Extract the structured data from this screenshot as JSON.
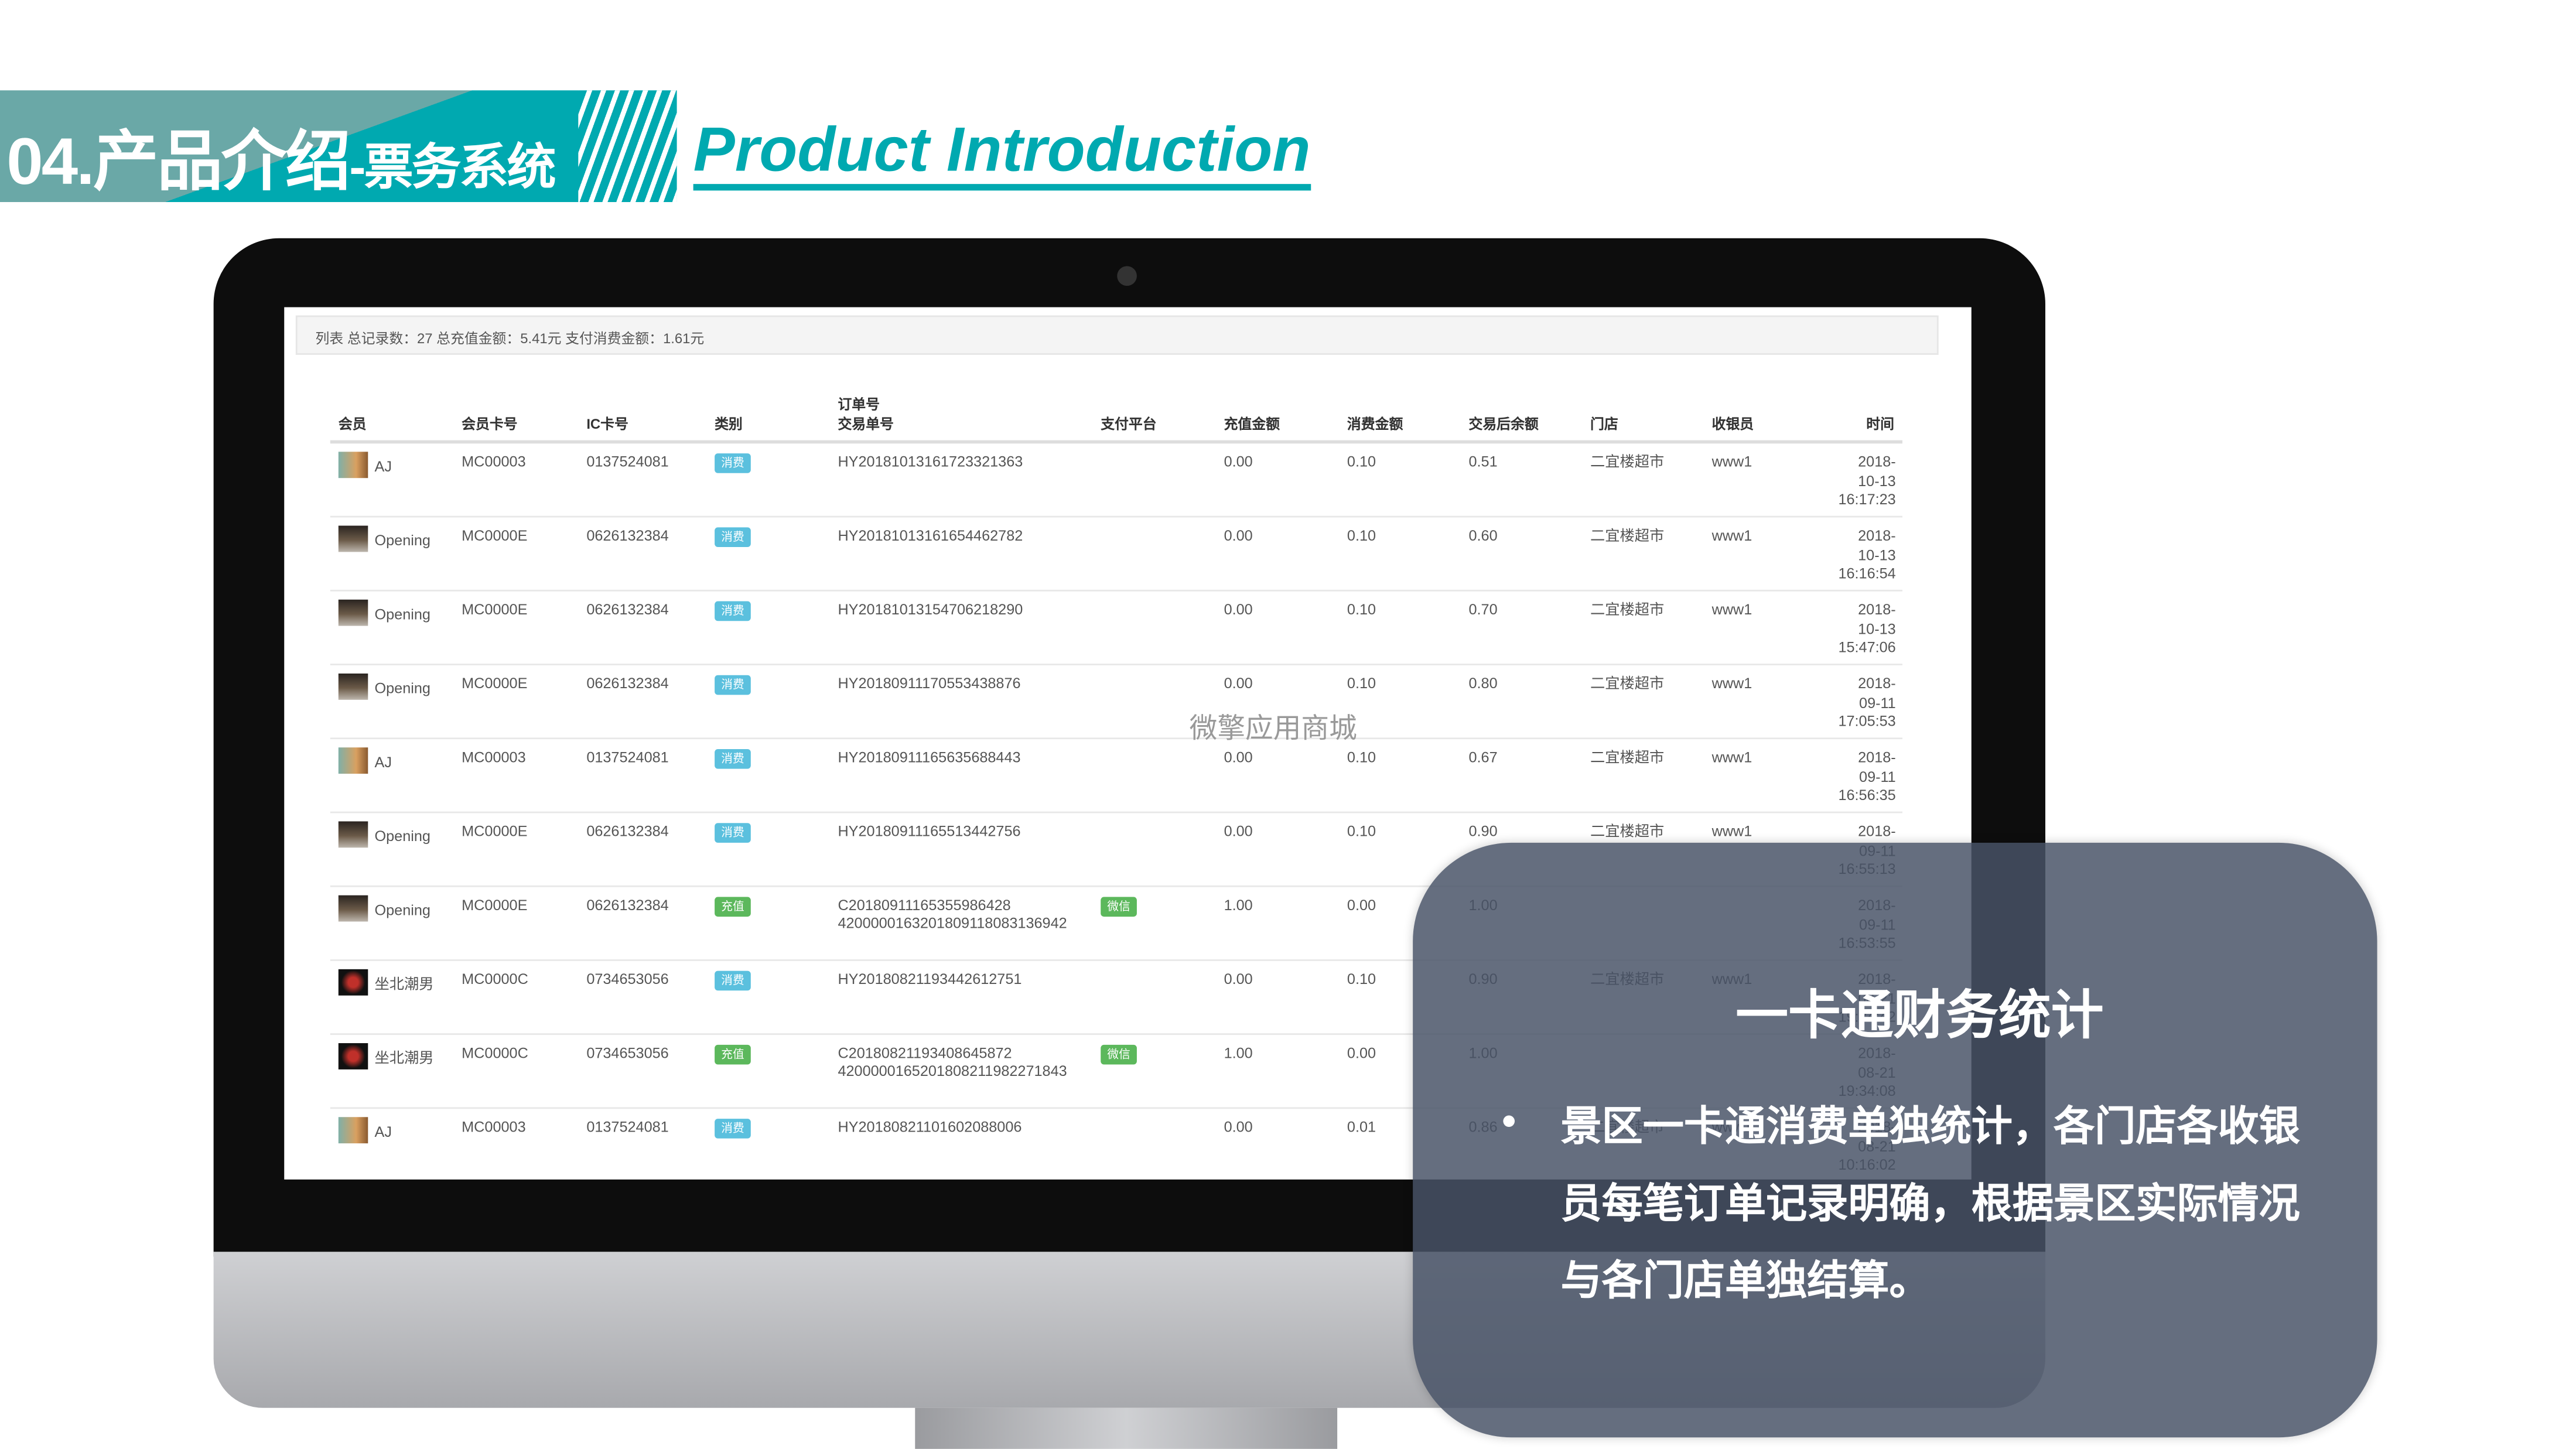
{
  "header": {
    "title": "04.产品介绍",
    "subtitle": "-票务系统",
    "english": "Product Introduction"
  },
  "colors": {
    "teal": "#00a9b0",
    "teal_gray": "#6aa8a7",
    "badge_consume": "#5bc0de",
    "badge_recharge": "#5cb85c",
    "panel": "#485266"
  },
  "screen": {
    "summary": "列表  总记录数：27  总充值金额：5.41元  支付消费金额：1.61元",
    "columns": {
      "member": "会员",
      "card_no": "会员卡号",
      "ic": "IC卡号",
      "type": "类别",
      "order_no": "订单号",
      "trade_no": "交易单号",
      "platform": "支付平台",
      "recharge": "充值金额",
      "consume": "消费金额",
      "balance": "交易后余额",
      "store": "门店",
      "cashier": "收银员",
      "time": "时间"
    },
    "watermark": "微擎应用商城",
    "rows": [
      {
        "avatar": "photo-icon",
        "name": "AJ",
        "card": "MC00003",
        "ic": "0137524081",
        "type": "消费",
        "order": "HY20181013161723321363",
        "trade": "",
        "platform": "",
        "recharge": "0.00",
        "consume": "0.10",
        "balance": "0.51",
        "store": "二宜楼超市",
        "cashier": "www1",
        "time": [
          "2018-",
          "10-13",
          "16:17:23"
        ]
      },
      {
        "avatar": "photo-icon",
        "name": "Opening",
        "card": "MC0000E",
        "ic": "0626132384",
        "type": "消费",
        "order": "HY20181013161654462782",
        "trade": "",
        "platform": "",
        "recharge": "0.00",
        "consume": "0.10",
        "balance": "0.60",
        "store": "二宜楼超市",
        "cashier": "www1",
        "time": [
          "2018-",
          "10-13",
          "16:16:54"
        ]
      },
      {
        "avatar": "photo-icon",
        "name": "Opening",
        "card": "MC0000E",
        "ic": "0626132384",
        "type": "消费",
        "order": "HY20181013154706218290",
        "trade": "",
        "platform": "",
        "recharge": "0.00",
        "consume": "0.10",
        "balance": "0.70",
        "store": "二宜楼超市",
        "cashier": "www1",
        "time": [
          "2018-",
          "10-13",
          "15:47:06"
        ]
      },
      {
        "avatar": "photo-icon",
        "name": "Opening",
        "card": "MC0000E",
        "ic": "0626132384",
        "type": "消费",
        "order": "HY20180911170553438876",
        "trade": "",
        "platform": "",
        "recharge": "0.00",
        "consume": "0.10",
        "balance": "0.80",
        "store": "二宜楼超市",
        "cashier": "www1",
        "time": [
          "2018-",
          "09-11",
          "17:05:53"
        ]
      },
      {
        "avatar": "photo-icon",
        "name": "AJ",
        "card": "MC00003",
        "ic": "0137524081",
        "type": "消费",
        "order": "HY20180911165635688443",
        "trade": "",
        "platform": "",
        "recharge": "0.00",
        "consume": "0.10",
        "balance": "0.67",
        "store": "二宜楼超市",
        "cashier": "www1",
        "time": [
          "2018-",
          "09-11",
          "16:56:35"
        ]
      },
      {
        "avatar": "photo-icon",
        "name": "Opening",
        "card": "MC0000E",
        "ic": "0626132384",
        "type": "消费",
        "order": "HY20180911165513442756",
        "trade": "",
        "platform": "",
        "recharge": "0.00",
        "consume": "0.10",
        "balance": "0.90",
        "store": "二宜楼超市",
        "cashier": "www1",
        "time": [
          "2018-",
          "09-11",
          "16:55:13"
        ]
      },
      {
        "avatar": "photo-icon",
        "name": "Opening",
        "card": "MC0000E",
        "ic": "0626132384",
        "type": "充值",
        "order": "C20180911165355986428",
        "trade": "4200000163201809118083136942",
        "platform": "微信",
        "recharge": "1.00",
        "consume": "0.00",
        "balance": "1.00",
        "store": "",
        "cashier": "",
        "time": [
          "2018-",
          "09-11",
          "16:53:55"
        ]
      },
      {
        "avatar": "photo-icon",
        "name": "坐北潮男",
        "card": "MC0000C",
        "ic": "0734653056",
        "type": "消费",
        "order": "HY20180821193442612751",
        "trade": "",
        "platform": "",
        "recharge": "0.00",
        "consume": "0.10",
        "balance": "0.90",
        "store": "二宜楼超市",
        "cashier": "www1",
        "time": [
          "2018-",
          "08-21",
          "19:34:42"
        ]
      },
      {
        "avatar": "photo-icon",
        "name": "坐北潮男",
        "card": "MC0000C",
        "ic": "0734653056",
        "type": "充值",
        "order": "C20180821193408645872",
        "trade": "4200000165201808211982271843",
        "platform": "微信",
        "recharge": "1.00",
        "consume": "0.00",
        "balance": "1.00",
        "store": "",
        "cashier": "",
        "time": [
          "2018-",
          "08-21",
          "19:34:08"
        ]
      },
      {
        "avatar": "photo-icon",
        "name": "AJ",
        "card": "MC00003",
        "ic": "0137524081",
        "type": "消费",
        "order": "HY20180821101602088006",
        "trade": "",
        "platform": "",
        "recharge": "0.00",
        "consume": "0.01",
        "balance": "0.86",
        "store": "二宜楼超市",
        "cashier": "www1",
        "time": [
          "2018-",
          "08-21",
          "10:16:02"
        ]
      }
    ]
  },
  "panel": {
    "title": "一卡通财务统计",
    "text": "景区一卡通消费单独统计，各门店各收银员每笔订单记录明确，根据景区实际情况与各门店单独结算。"
  }
}
